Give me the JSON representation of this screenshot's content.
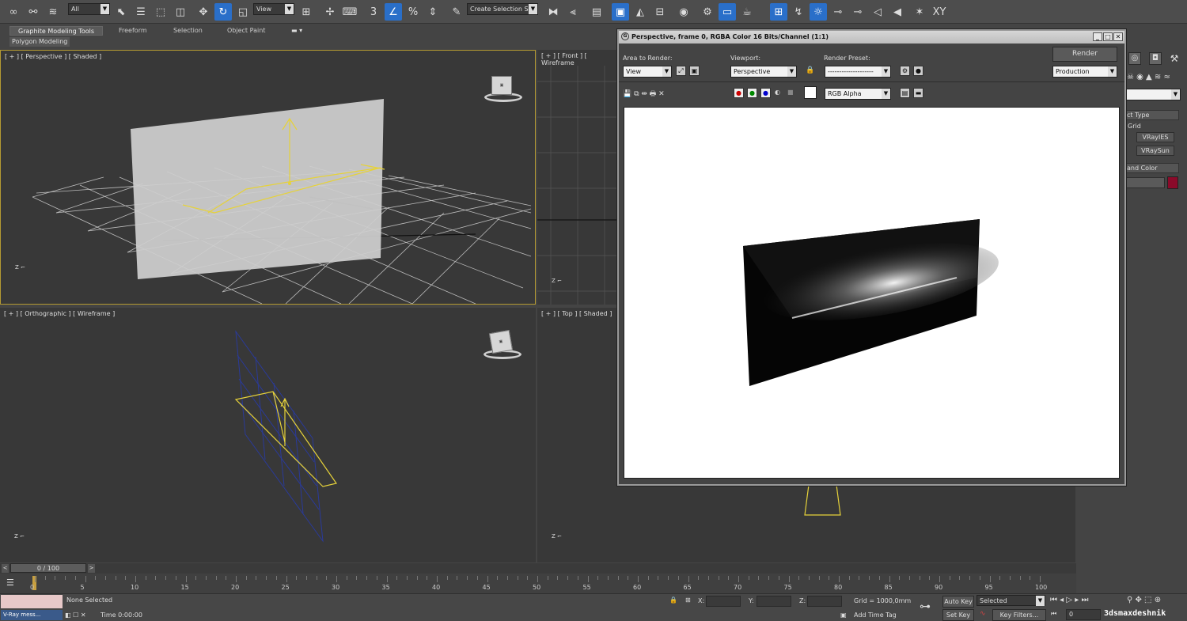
{
  "toolbar": {
    "selection_filter": "All",
    "ref_coord": "View",
    "named_selection": "Create Selection Se",
    "snap_3d": "3",
    "axis_label": "XY"
  },
  "ribbon": {
    "tabs": [
      "Graphite Modeling Tools",
      "Freeform",
      "Selection",
      "Object Paint"
    ],
    "sub_tab": "Polygon Modeling"
  },
  "viewports": {
    "perspective_label": "[ + ] [ Perspective ] [ Shaded ]",
    "front_label": "[ + ] [ Front ] [ Wireframe",
    "ortho_label": "[ + ] [ Orthographic ] [ Wireframe ]",
    "top_label": "[ + ] [ Top ] [ Shaded ]"
  },
  "render_window": {
    "title": "Perspective, frame 0, RGBA Color 16 Bits/Channel (1:1)",
    "area_to_render_label": "Area to Render:",
    "area_to_render_value": "View",
    "viewport_label": "Viewport:",
    "viewport_value": "Perspective",
    "render_preset_label": "Render Preset:",
    "render_preset_value": "--------------------",
    "render_button": "Render",
    "production_value": "Production",
    "channel_value": "RGB Alpha"
  },
  "command_panel": {
    "rollout_object_type": "ct Type",
    "autogrid": "Grid",
    "btn_vrayies": "VRayIES",
    "btn_vraysun": "VRaySun",
    "rollout_name_color": "and Color",
    "color_swatch": "#8b0a2a"
  },
  "timeline": {
    "frame_counter": "0 / 100",
    "ticks": [
      "0",
      "5",
      "10",
      "15",
      "20",
      "25",
      "30",
      "35",
      "40",
      "45",
      "50",
      "55",
      "60",
      "65",
      "70",
      "75",
      "80",
      "85",
      "90",
      "95",
      "100"
    ]
  },
  "status": {
    "maxscript_text": "V-Ray mess...",
    "selection_status": "None Selected",
    "time_prompt": "Time  0:00:00",
    "x_label": "X:",
    "y_label": "Y:",
    "z_label": "Z:",
    "grid_text": "Grid = 1000,0mm",
    "add_time_tag": "Add Time Tag",
    "auto_key": "Auto Key",
    "set_key": "Set Key",
    "key_mode_value": "Selected",
    "key_filters": "Key Filters...",
    "current_frame": "0",
    "watermark": "3dsmaxdeshnik"
  }
}
